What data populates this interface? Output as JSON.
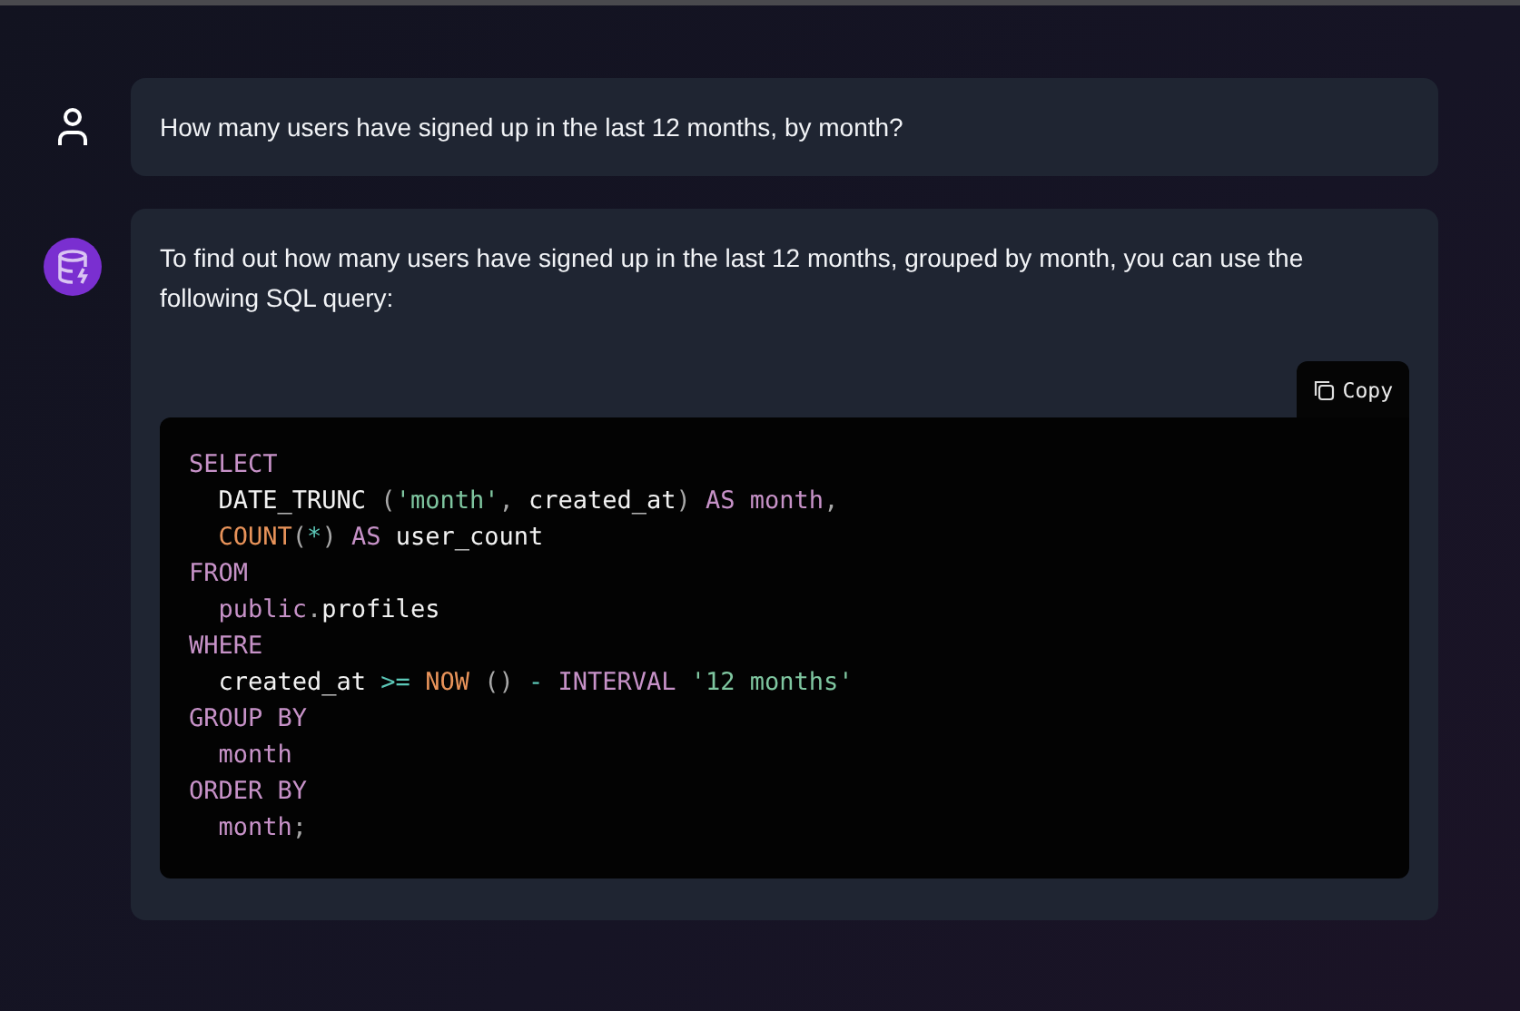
{
  "messages": [
    {
      "kind": "user",
      "text": "How many users have signed up in the last 12 months, by month?"
    },
    {
      "kind": "assistant",
      "text": "To find out how many users have signed up in the last 12 months, grouped by month, you can use the following SQL query:",
      "code": {
        "copy_label": "Copy",
        "lines": [
          {
            "tokens": [
              {
                "kind": "keyword",
                "text": "SELECT"
              }
            ]
          },
          {
            "tokens": [
              {
                "kind": "plain",
                "text": "  DATE_TRUNC "
              },
              {
                "kind": "punct",
                "text": "("
              },
              {
                "kind": "string",
                "text": "'month'"
              },
              {
                "kind": "punct",
                "text": ", "
              },
              {
                "kind": "plain",
                "text": "created_at"
              },
              {
                "kind": "punct",
                "text": ") "
              },
              {
                "kind": "keyword",
                "text": "AS month"
              },
              {
                "kind": "punct",
                "text": ","
              }
            ]
          },
          {
            "tokens": [
              {
                "kind": "func",
                "text": "  COUNT"
              },
              {
                "kind": "punct",
                "text": "("
              },
              {
                "kind": "op",
                "text": "*"
              },
              {
                "kind": "punct",
                "text": ") "
              },
              {
                "kind": "keyword",
                "text": "AS "
              },
              {
                "kind": "plain",
                "text": "user_count"
              }
            ]
          },
          {
            "tokens": [
              {
                "kind": "keyword",
                "text": "FROM"
              }
            ]
          },
          {
            "tokens": [
              {
                "kind": "keyword",
                "text": "  public"
              },
              {
                "kind": "punct",
                "text": "."
              },
              {
                "kind": "plain",
                "text": "profiles"
              }
            ]
          },
          {
            "tokens": [
              {
                "kind": "keyword",
                "text": "WHERE"
              }
            ]
          },
          {
            "tokens": [
              {
                "kind": "plain",
                "text": "  created_at "
              },
              {
                "kind": "op",
                "text": ">= "
              },
              {
                "kind": "func",
                "text": "NOW "
              },
              {
                "kind": "punct",
                "text": "() "
              },
              {
                "kind": "op",
                "text": "- "
              },
              {
                "kind": "keyword",
                "text": "INTERVAL "
              },
              {
                "kind": "string",
                "text": "'12 months'"
              }
            ]
          },
          {
            "tokens": [
              {
                "kind": "keyword",
                "text": "GROUP BY"
              }
            ]
          },
          {
            "tokens": [
              {
                "kind": "keyword",
                "text": "  month"
              }
            ]
          },
          {
            "tokens": [
              {
                "kind": "keyword",
                "text": "ORDER BY"
              }
            ]
          },
          {
            "tokens": [
              {
                "kind": "keyword",
                "text": "  month"
              },
              {
                "kind": "punct",
                "text": ";"
              }
            ]
          }
        ]
      }
    }
  ]
}
